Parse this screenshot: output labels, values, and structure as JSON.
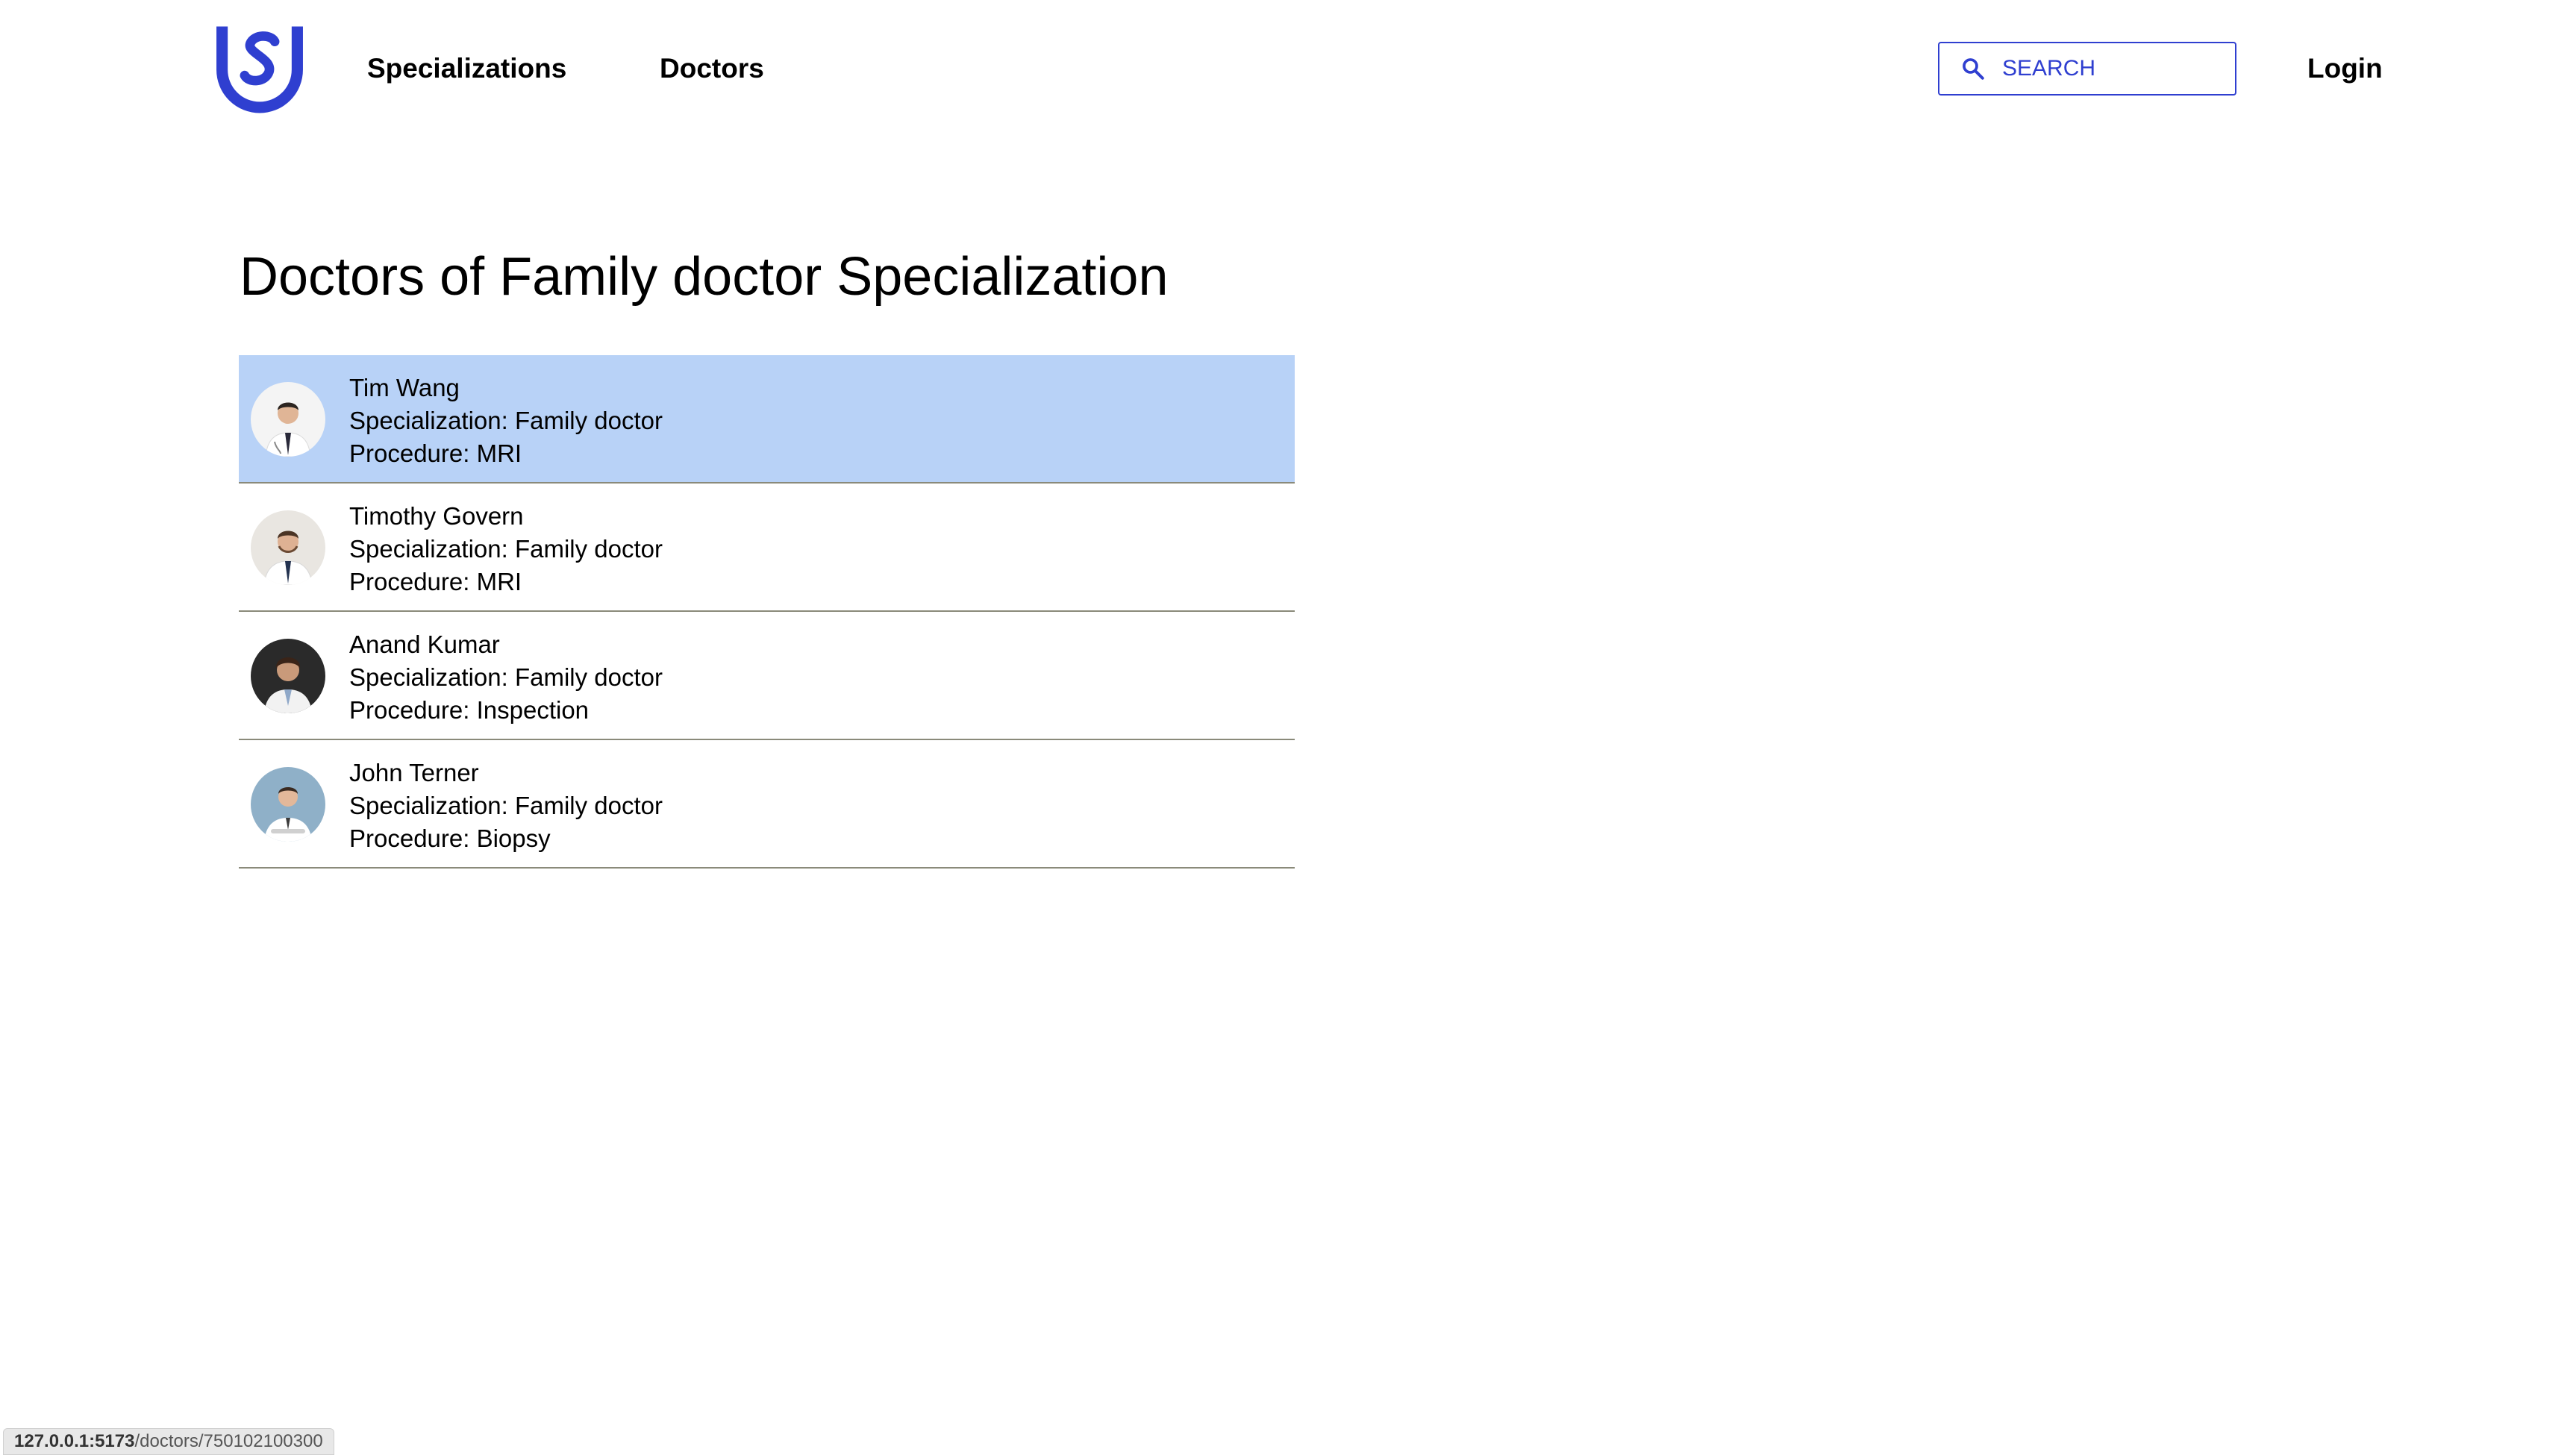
{
  "nav": {
    "logo_icon": "shield-s-logo-icon",
    "links": [
      {
        "label": "Specializations"
      },
      {
        "label": "Doctors"
      }
    ],
    "search": {
      "placeholder": "SEARCH",
      "icon": "search-icon"
    },
    "login_label": "Login"
  },
  "colors": {
    "brand": "#2f3fd0",
    "selected_row": "#b8d2f7",
    "row_divider": "#8a8a7a"
  },
  "page": {
    "title": "Doctors of Family doctor Specialization"
  },
  "doctors": [
    {
      "name": "Tim Wang",
      "specialization": "Specialization: Family doctor",
      "procedure": "Procedure: MRI",
      "selected": true,
      "avatar": "doctor-photo"
    },
    {
      "name": "Timothy Govern",
      "specialization": "Specialization: Family doctor",
      "procedure": "Procedure: MRI",
      "selected": false,
      "avatar": "doctor-photo"
    },
    {
      "name": "Anand Kumar",
      "specialization": "Specialization: Family doctor",
      "procedure": "Procedure: Inspection",
      "selected": false,
      "avatar": "doctor-photo"
    },
    {
      "name": "John Terner",
      "specialization": "Specialization: Family doctor",
      "procedure": "Procedure: Biopsy",
      "selected": false,
      "avatar": "doctor-photo"
    }
  ],
  "status_bar": {
    "host": "127.0.0.1:5173",
    "path": "/doctors/750102100300"
  }
}
